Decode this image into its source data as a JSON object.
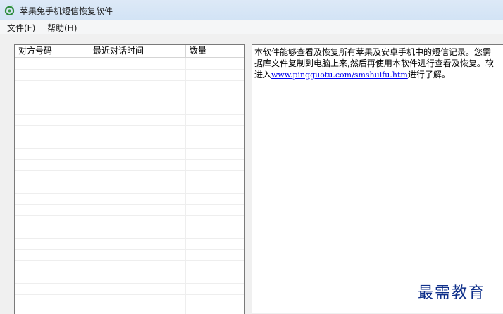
{
  "window": {
    "title": "苹果兔手机短信恢复软件",
    "icon": "app-logo-icon"
  },
  "menu": {
    "items": [
      {
        "label": "文件(F)"
      },
      {
        "label": "帮助(H)"
      }
    ]
  },
  "list": {
    "columns": [
      {
        "label": "对方号码"
      },
      {
        "label": "最近对话时间"
      },
      {
        "label": "数量"
      }
    ],
    "rows": []
  },
  "info": {
    "line1": "本软件能够查看及恢复所有苹果及安卓手机中的短信记录。您需",
    "line2": "据库文件复制到电脑上来,然后再使用本软件进行查看及恢复。软",
    "line3_prefix": "进入",
    "link": "www.pingguotu.com/smshuifu.htm",
    "line3_suffix": "进行了解。"
  },
  "watermark": "最需教育",
  "colors": {
    "titlebar": "#d9e6f5",
    "link": "#0000ee",
    "watermark": "#0e2f8a"
  }
}
